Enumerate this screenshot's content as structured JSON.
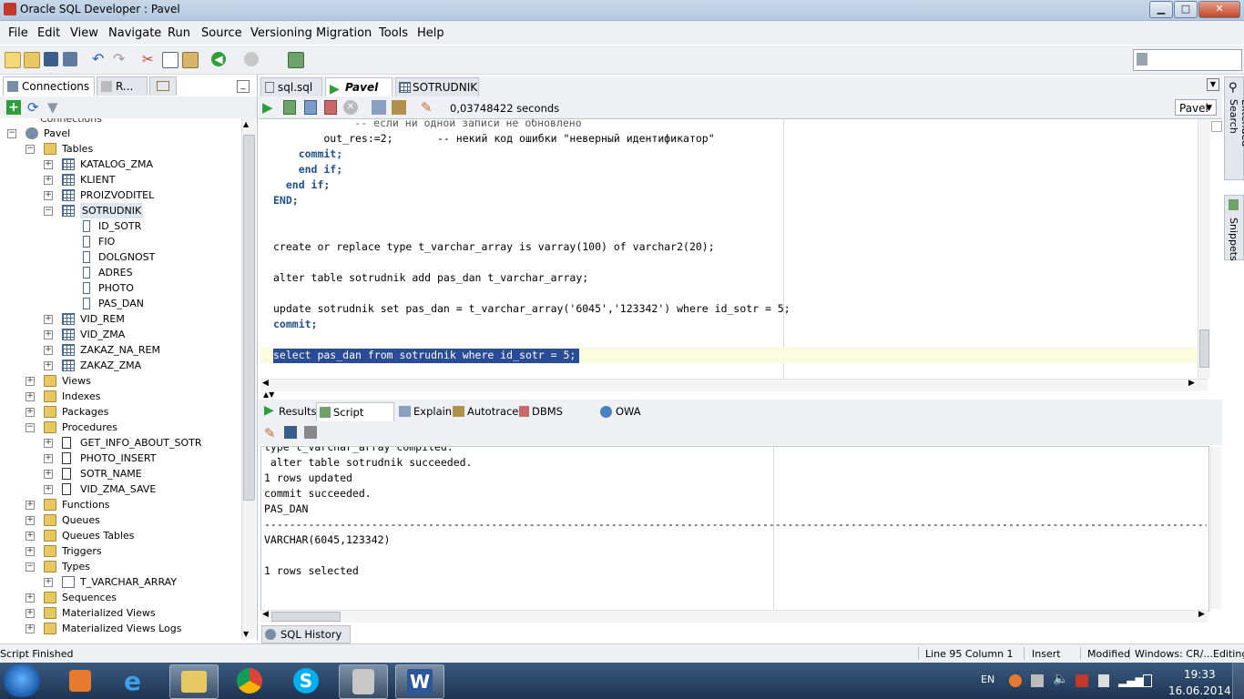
{
  "window": {
    "title": "Oracle SQL Developer : Pavel",
    "minimize": "▁",
    "maximize": "□",
    "close": "✕"
  },
  "menu": [
    "File",
    "Edit",
    "View",
    "Navigate",
    "Run",
    "Source",
    "Versioning",
    "Migration",
    "Tools",
    "Help"
  ],
  "left_panel": {
    "tabs": [
      "Connections",
      "R..."
    ],
    "tree_header": "Connections",
    "tree": [
      {
        "label": "Pavel",
        "depth": 0,
        "icon": "connection-icon",
        "expanded": true
      },
      {
        "label": "Tables",
        "depth": 1,
        "icon": "folder-icon",
        "expanded": true
      },
      {
        "label": "KATALOG_ZMA",
        "depth": 2,
        "icon": "table-icon",
        "expanded": false
      },
      {
        "label": "KLIENT",
        "depth": 2,
        "icon": "table-icon",
        "expanded": false
      },
      {
        "label": "PROIZVODITEL",
        "depth": 2,
        "icon": "table-icon",
        "expanded": false
      },
      {
        "label": "SOTRUDNIK",
        "depth": 2,
        "icon": "table-icon",
        "expanded": true,
        "selected": true
      },
      {
        "label": "ID_SOTR",
        "depth": 3,
        "icon": "column-icon"
      },
      {
        "label": "FIO",
        "depth": 3,
        "icon": "column-icon"
      },
      {
        "label": "DOLGNOST",
        "depth": 3,
        "icon": "column-icon"
      },
      {
        "label": "ADRES",
        "depth": 3,
        "icon": "column-icon"
      },
      {
        "label": "PHOTO",
        "depth": 3,
        "icon": "column-icon"
      },
      {
        "label": "PAS_DAN",
        "depth": 3,
        "icon": "column-icon"
      },
      {
        "label": "VID_REM",
        "depth": 2,
        "icon": "table-icon",
        "expanded": false
      },
      {
        "label": "VID_ZMA",
        "depth": 2,
        "icon": "table-icon",
        "expanded": false
      },
      {
        "label": "ZAKAZ_NA_REM",
        "depth": 2,
        "icon": "table-icon",
        "expanded": false
      },
      {
        "label": "ZAKAZ_ZMA",
        "depth": 2,
        "icon": "table-icon",
        "expanded": false
      },
      {
        "label": "Views",
        "depth": 1,
        "icon": "folder-icon",
        "expanded": false
      },
      {
        "label": "Indexes",
        "depth": 1,
        "icon": "folder-icon",
        "expanded": false
      },
      {
        "label": "Packages",
        "depth": 1,
        "icon": "folder-icon",
        "expanded": false
      },
      {
        "label": "Procedures",
        "depth": 1,
        "icon": "folder-icon",
        "expanded": true
      },
      {
        "label": "GET_INFO_ABOUT_SOTR",
        "depth": 2,
        "icon": "procedure-icon",
        "expanded": false
      },
      {
        "label": "PHOTO_INSERT",
        "depth": 2,
        "icon": "procedure-icon",
        "expanded": false
      },
      {
        "label": "SOTR_NAME",
        "depth": 2,
        "icon": "procedure-icon",
        "expanded": false
      },
      {
        "label": "VID_ZMA_SAVE",
        "depth": 2,
        "icon": "procedure-icon",
        "expanded": false
      },
      {
        "label": "Functions",
        "depth": 1,
        "icon": "folder-icon",
        "expanded": false
      },
      {
        "label": "Queues",
        "depth": 1,
        "icon": "folder-icon",
        "expanded": false
      },
      {
        "label": "Queues Tables",
        "depth": 1,
        "icon": "folder-icon",
        "expanded": false
      },
      {
        "label": "Triggers",
        "depth": 1,
        "icon": "folder-icon",
        "expanded": false
      },
      {
        "label": "Types",
        "depth": 1,
        "icon": "folder-icon",
        "expanded": true
      },
      {
        "label": "T_VARCHAR_ARRAY",
        "depth": 2,
        "icon": "type-icon",
        "expanded": false
      },
      {
        "label": "Sequences",
        "depth": 1,
        "icon": "folder-icon",
        "expanded": false
      },
      {
        "label": "Materialized Views",
        "depth": 1,
        "icon": "folder-icon",
        "expanded": false
      },
      {
        "label": "Materialized Views Logs",
        "depth": 1,
        "icon": "folder-icon",
        "expanded": false
      }
    ]
  },
  "editor": {
    "tabs": [
      "sql.sql",
      "Pavel",
      "SOTRUDNIK"
    ],
    "active_tab": "Pavel",
    "exec_time": "0,03748422 seconds",
    "connection": "Pavel",
    "code_lines": [
      "        -- если ни одной записи не обновлено",
      "        out_res:=2;       -- некий код ошибки \"неверный идентификатор\"",
      "    commit;",
      "    end if;",
      "  end if;",
      "END;",
      "",
      "",
      "create or replace type t_varchar_array is varray(100) of varchar2(20);",
      "",
      "alter table sotrudnik add pas_dan t_varchar_array;",
      "",
      "update sotrudnik set pas_dan = t_varchar_array('6045','123342') where id_sotr = 5;",
      "commit;",
      "",
      "select pas_dan from sotrudnik where id_sotr = 5;"
    ]
  },
  "output": {
    "tabs": [
      "Results",
      "Script Output",
      "Explain",
      "Autotrace",
      "DBMS Output",
      "OWA Output"
    ],
    "active_tab": "Script Output",
    "lines": [
      "type t_varchar_array compiled.",
      " alter table sotrudnik succeeded.",
      "1 rows updated",
      "commit succeeded.",
      "PAS_DAN",
      "------------------------------------------------------------------------------------------------------------------------------------------------------------------------",
      "VARCHAR(6045,123342)",
      "",
      "1 rows selected"
    ],
    "sql_history": "SQL History"
  },
  "right_tabs": [
    "Extended Search",
    "Snippets"
  ],
  "status": {
    "message": "Script Finished",
    "position": "Line 95 Column 1",
    "mode": "Insert",
    "modified": "Modified",
    "line_endings": "Windows: CR/...",
    "edit_state": "Editing"
  },
  "taskbar": {
    "lang": "EN",
    "time": "19:33",
    "date": "16.06.2014"
  },
  "colors": {
    "selection": "#2a4b96",
    "keyword": "#1f4f8f",
    "titlebar": "#c8d8ea",
    "taskbar": "#1e3452"
  }
}
